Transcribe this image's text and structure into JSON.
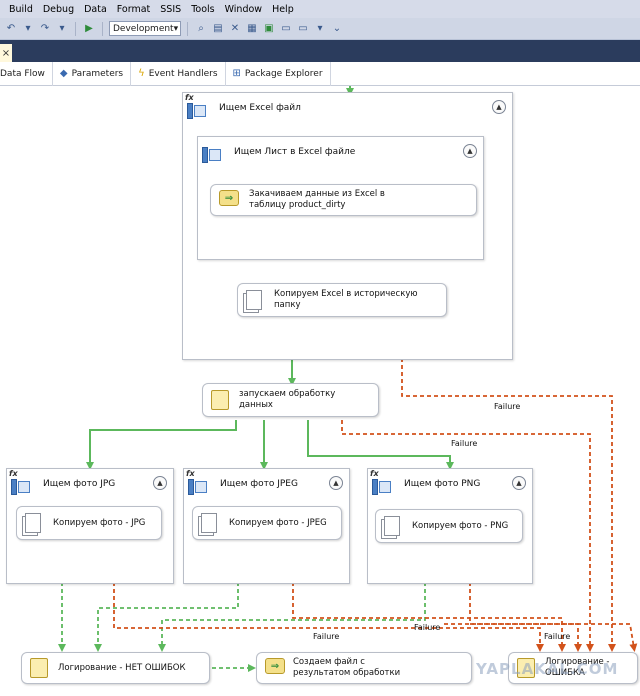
{
  "menu": [
    "Build",
    "Debug",
    "Data",
    "Format",
    "SSIS",
    "Tools",
    "Window",
    "Help"
  ],
  "toolbar": {
    "configuration": "Development"
  },
  "tabs": [
    "Data Flow",
    "Parameters",
    "Event Handlers",
    "Package Explorer"
  ],
  "containers": {
    "excel_loop": "Ищем Excel файл",
    "sheet_loop": "Ищем Лист в Excel файле",
    "jpg_loop": "Ищем фото JPG",
    "jpeg_loop": "Ищем фото JPEG",
    "png_loop": "Ищем фото PNG"
  },
  "tasks": {
    "load_excel": "Закачиваем данные из Excel в таблицу product_dirty",
    "copy_excel": "Копируем Excel в историческую папку",
    "start_processing": "запускаем обработку данных",
    "copy_jpg": "Копируем фото - JPG",
    "copy_jpeg": "Копируем фото - JPEG",
    "copy_png": "Копируем фото - PNG",
    "log_ok": "Логирование - НЕТ ОШИБОК",
    "result_file": "Создаем файл с результатом обработки",
    "log_error": "Логирование - ОШИБКА"
  },
  "failure_label": "Failure",
  "watermark": "YAPLAKAL.COM",
  "colors": {
    "success": "#5cb85c",
    "failure": "#d2521b"
  }
}
